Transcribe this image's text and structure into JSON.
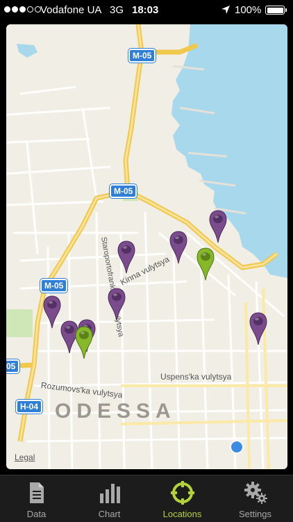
{
  "status_bar": {
    "carrier": "Vodafone UA",
    "network": "3G",
    "time": "18:03",
    "battery": "100%",
    "signal_filled": 3,
    "signal_total": 5
  },
  "map": {
    "city_label": "ODESSA",
    "legal": "Legal",
    "streets": [
      {
        "name": "Kinna vulytsya"
      },
      {
        "name": "Staroportofrankivs'ka vulytsya"
      },
      {
        "name": "Uspens'ka vulytsya"
      },
      {
        "name": "Rozumovs'ka vulytsya"
      }
    ],
    "road_shields": [
      "M-05",
      "M-05",
      "M-05",
      "05",
      "H-04"
    ],
    "pins": [
      {
        "color": "purple"
      },
      {
        "color": "purple"
      },
      {
        "color": "purple"
      },
      {
        "color": "green"
      },
      {
        "color": "purple"
      },
      {
        "color": "purple"
      },
      {
        "color": "purple"
      },
      {
        "color": "purple"
      },
      {
        "color": "green"
      },
      {
        "color": "purple"
      }
    ],
    "colors": {
      "land": "#f1eee6",
      "water": "#a8d8ec",
      "highway": "#f6d66a",
      "pin_purple": "#7a4c8c",
      "pin_green": "#86b82a"
    }
  },
  "tabs": [
    {
      "label": "Data",
      "icon": "document-icon",
      "active": false
    },
    {
      "label": "Chart",
      "icon": "bar-chart-icon",
      "active": false
    },
    {
      "label": "Locations",
      "icon": "crosshair-icon",
      "active": true
    },
    {
      "label": "Settings",
      "icon": "gears-icon",
      "active": false
    }
  ]
}
